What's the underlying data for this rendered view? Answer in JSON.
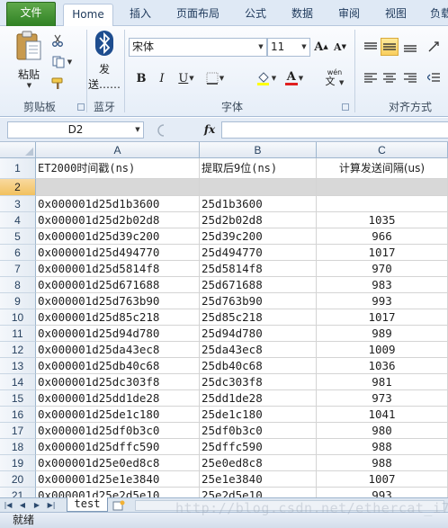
{
  "ribbon_tabs": [
    {
      "label": "文件"
    },
    {
      "label": "Home"
    },
    {
      "label": "插入"
    },
    {
      "label": "页面布局"
    },
    {
      "label": "公式"
    },
    {
      "label": "数据"
    },
    {
      "label": "审阅"
    },
    {
      "label": "视图"
    },
    {
      "label": "负载"
    }
  ],
  "clipboard": {
    "paste_label": "粘贴",
    "group_label": "剪贴板"
  },
  "bluetooth": {
    "send_label_1": "发",
    "send_label_2": "送……",
    "group_label": "蓝牙"
  },
  "font": {
    "name": "宋体",
    "size": "11",
    "grow": "A",
    "shrink": "A",
    "bold": "B",
    "italic": "I",
    "underline": "U",
    "color_letter": "A",
    "wen": "wén",
    "group_label": "字体"
  },
  "alignment": {
    "group_label": "对齐方式"
  },
  "formula_bar": {
    "name_box": "D2",
    "fx": "fx",
    "value": ""
  },
  "columns": [
    "A",
    "B",
    "C"
  ],
  "header_row": {
    "row": "1",
    "a": "ET2000时间戳(ns)",
    "b": "提取后9位(ns)",
    "c": "计算发送间隔(us)"
  },
  "rows": [
    {
      "row": "2",
      "a": "",
      "b": "",
      "c": ""
    },
    {
      "row": "3",
      "a": "0x000001d25d1b3600",
      "b": "25d1b3600",
      "c": ""
    },
    {
      "row": "4",
      "a": "0x000001d25d2b02d8",
      "b": "25d2b02d8",
      "c": "1035"
    },
    {
      "row": "5",
      "a": "0x000001d25d39c200",
      "b": "25d39c200",
      "c": "966"
    },
    {
      "row": "6",
      "a": "0x000001d25d494770",
      "b": "25d494770",
      "c": "1017"
    },
    {
      "row": "7",
      "a": "0x000001d25d5814f8",
      "b": "25d5814f8",
      "c": "970"
    },
    {
      "row": "8",
      "a": "0x000001d25d671688",
      "b": "25d671688",
      "c": "983"
    },
    {
      "row": "9",
      "a": "0x000001d25d763b90",
      "b": "25d763b90",
      "c": "993"
    },
    {
      "row": "10",
      "a": "0x000001d25d85c218",
      "b": "25d85c218",
      "c": "1017"
    },
    {
      "row": "11",
      "a": "0x000001d25d94d780",
      "b": "25d94d780",
      "c": "989"
    },
    {
      "row": "12",
      "a": "0x000001d25da43ec8",
      "b": "25da43ec8",
      "c": "1009"
    },
    {
      "row": "13",
      "a": "0x000001d25db40c68",
      "b": "25db40c68",
      "c": "1036"
    },
    {
      "row": "14",
      "a": "0x000001d25dc303f8",
      "b": "25dc303f8",
      "c": "981"
    },
    {
      "row": "15",
      "a": "0x000001d25dd1de28",
      "b": "25dd1de28",
      "c": "973"
    },
    {
      "row": "16",
      "a": "0x000001d25de1c180",
      "b": "25de1c180",
      "c": "1041"
    },
    {
      "row": "17",
      "a": "0x000001d25df0b3c0",
      "b": "25df0b3c0",
      "c": "980"
    },
    {
      "row": "18",
      "a": "0x000001d25dffc590",
      "b": "25dffc590",
      "c": "988"
    },
    {
      "row": "19",
      "a": "0x000001d25e0ed8c8",
      "b": "25e0ed8c8",
      "c": "988"
    },
    {
      "row": "20",
      "a": "0x000001d25e1e3840",
      "b": "25e1e3840",
      "c": "1007"
    },
    {
      "row": "21",
      "a": "0x000001d25e2d5e10",
      "b": "25e2d5e10",
      "c": "993"
    }
  ],
  "sheets": [
    {
      "label": "test"
    }
  ],
  "status": {
    "text": "就绪"
  },
  "watermark": "http://blog.csdn.net/ethercat_i7"
}
